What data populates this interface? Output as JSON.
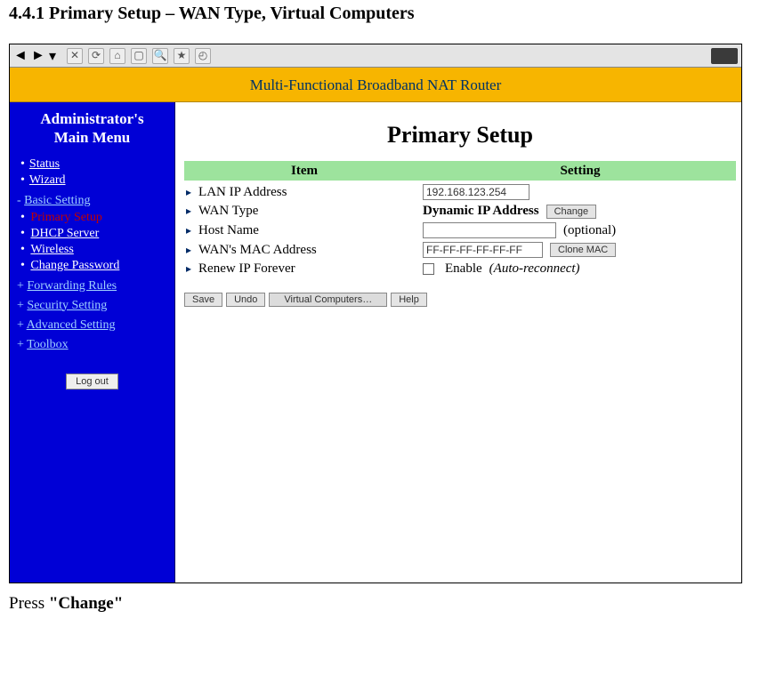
{
  "doc": {
    "heading": "4.4.1 Primary Setup – WAN Type, Virtual Computers",
    "footer_prefix": "Press ",
    "footer_bold": "\"Change\""
  },
  "toolbar": {
    "icons": [
      "back",
      "forward",
      "dropdown",
      "stop",
      "refresh",
      "home",
      "search",
      "favorites",
      "history"
    ]
  },
  "banner": {
    "text": "Multi-Functional Broadband NAT Router"
  },
  "sidebar": {
    "title_line1": "Administrator's",
    "title_line2": "Main Menu",
    "top_items": [
      {
        "label": "Status"
      },
      {
        "label": "Wizard"
      }
    ],
    "basic_setting": {
      "label": "Basic Setting",
      "items": [
        {
          "label": "Primary Setup",
          "active": true
        },
        {
          "label": "DHCP Server"
        },
        {
          "label": "Wireless"
        },
        {
          "label": "Change Password"
        }
      ]
    },
    "collapsed": [
      {
        "label": "Forwarding Rules"
      },
      {
        "label": "Security Setting"
      },
      {
        "label": "Advanced Setting"
      },
      {
        "label": "Toolbox"
      }
    ],
    "logout_label": "Log out"
  },
  "main": {
    "title": "Primary Setup",
    "col_item": "Item",
    "col_setting": "Setting",
    "rows": {
      "lan_ip": {
        "label": "LAN IP Address",
        "value": "192.168.123.254"
      },
      "wan_type": {
        "label": "WAN Type",
        "bold_text": "Dynamic IP Address",
        "button": "Change"
      },
      "host": {
        "label": "Host Name",
        "value": "",
        "note": "(optional)"
      },
      "mac": {
        "label": "WAN's MAC Address",
        "value": "FF-FF-FF-FF-FF-FF",
        "button": "Clone MAC"
      },
      "renew": {
        "label": "Renew IP Forever",
        "checkbox_label": "Enable",
        "italic": "(Auto-reconnect)"
      }
    },
    "buttons": {
      "save": "Save",
      "undo": "Undo",
      "virtual": "Virtual Computers…",
      "help": "Help"
    }
  }
}
